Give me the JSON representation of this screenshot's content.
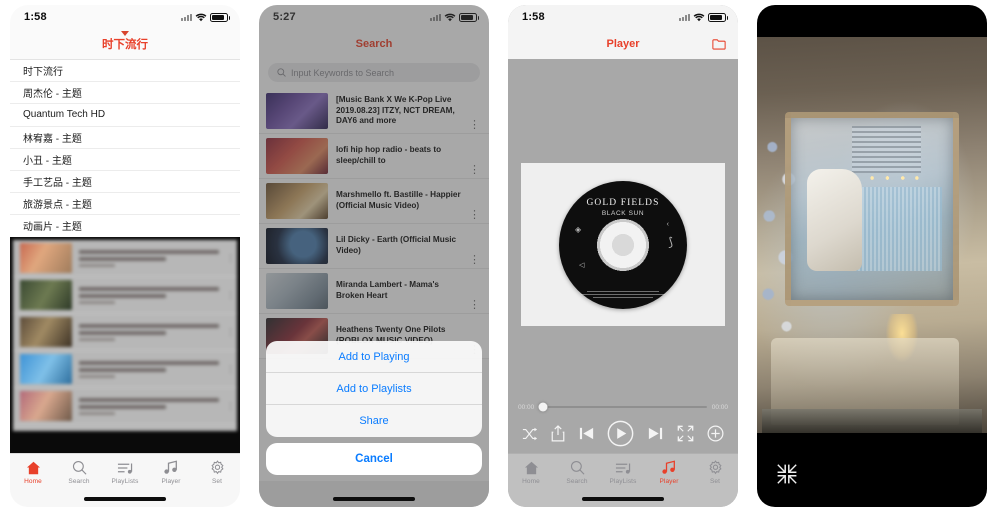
{
  "panels": {
    "home": {
      "status": {
        "time": "1:58"
      },
      "nav": {
        "title": "时下流行"
      },
      "dropdown_items": [
        {
          "label": "时下流行"
        },
        {
          "label": "周杰伦 - 主题"
        },
        {
          "label": "Quantum Tech HD"
        },
        {
          "label": "林宥嘉 - 主题"
        },
        {
          "label": "小丑 - 主题"
        },
        {
          "label": "手工艺品 - 主题"
        },
        {
          "label": "旅游景点 - 主题"
        },
        {
          "label": "动画片 - 主题"
        }
      ],
      "tabs": [
        {
          "label": "Home",
          "icon": "home-icon",
          "active": true
        },
        {
          "label": "Search",
          "icon": "search-icon",
          "active": false
        },
        {
          "label": "PlayLists",
          "icon": "playlist-icon",
          "active": false
        },
        {
          "label": "Player",
          "icon": "music-note-icon",
          "active": false
        },
        {
          "label": "Set",
          "icon": "gear-icon",
          "active": false
        }
      ]
    },
    "search": {
      "status": {
        "time": "5:27"
      },
      "nav": {
        "title": "Search"
      },
      "search_field": {
        "value": "",
        "placeholder": "Input Keywords to Search"
      },
      "results": [
        {
          "title": "[Music Bank X We K-Pop Live 2019.08.23] ITZY, NCT DREAM, DAY6 and more"
        },
        {
          "title": "lofi hip hop radio - beats to sleep/chill to"
        },
        {
          "title": "Marshmello ft. Bastille - Happier (Official Music Video)"
        },
        {
          "title": "Lil Dicky - Earth (Official Music Video)"
        },
        {
          "title": "Miranda Lambert - Mama's Broken Heart"
        },
        {
          "title": "Heathens Twenty One Pilots (ROBLOX MUSIC VIDEO)"
        }
      ],
      "action_sheet": {
        "options": [
          {
            "label": "Add to Playing"
          },
          {
            "label": "Add to Playlists"
          },
          {
            "label": "Share"
          }
        ],
        "cancel_label": "Cancel"
      }
    },
    "player": {
      "status": {
        "time": "1:58"
      },
      "nav": {
        "title": "Player",
        "right_icon": "folder-icon"
      },
      "artwork": {
        "title": "GOLD FIELDS",
        "subtitle": "BLACK SUN"
      },
      "progress": {
        "elapsed": "00:00",
        "duration": "00:00",
        "percent": 2
      },
      "controls": [
        {
          "name": "shuffle-button",
          "icon": "shuffle-icon"
        },
        {
          "name": "share-button",
          "icon": "share-icon"
        },
        {
          "name": "previous-button",
          "icon": "previous-icon"
        },
        {
          "name": "play-button",
          "icon": "play-icon"
        },
        {
          "name": "next-button",
          "icon": "next-icon"
        },
        {
          "name": "fullscreen-button",
          "icon": "fullscreen-icon"
        },
        {
          "name": "add-button",
          "icon": "plus-icon"
        }
      ],
      "tabs": [
        {
          "label": "Home",
          "icon": "home-icon",
          "active": false
        },
        {
          "label": "Search",
          "icon": "search-icon",
          "active": false
        },
        {
          "label": "PlayLists",
          "icon": "playlist-icon",
          "active": false
        },
        {
          "label": "Player",
          "icon": "music-note-icon",
          "active": true
        },
        {
          "label": "Set",
          "icon": "gear-icon",
          "active": false
        }
      ]
    },
    "fullscreen": {
      "exit_icon": "exit-fullscreen-icon"
    }
  },
  "colors": {
    "accent": "#e8402a",
    "link": "#0a7cff",
    "tab_inactive": "#8e8e93"
  }
}
